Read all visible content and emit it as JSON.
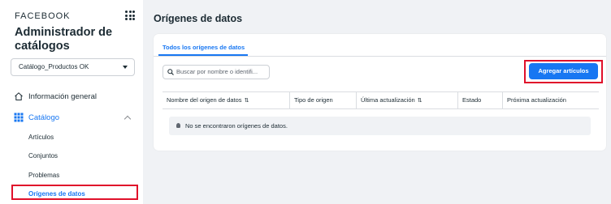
{
  "sidebar": {
    "brand": "FACEBOOK",
    "title": "Administrador de catálogos",
    "catalog_select": "Catálogo_Productos OK",
    "nav": {
      "general_info": "Información general",
      "catalog": "Catálogo"
    },
    "catalog_items": [
      "Artículos",
      "Conjuntos",
      "Problemas",
      "Orígenes de datos"
    ]
  },
  "main": {
    "title": "Orígenes de datos",
    "tab_all": "Todos los orígenes de datos",
    "search_placeholder": "Buscar por nombre o identifi...",
    "add_button": "Agregar artículos",
    "columns": [
      "Nombre del origen de datos",
      "Tipo de origen",
      "Última actualización",
      "Estado",
      "Próxima actualización"
    ],
    "sort_icon": "⇅",
    "empty_message": "No se encontraron orígenes de datos."
  },
  "colors": {
    "accent": "#1877f2",
    "highlight": "#e0102a",
    "background": "#f0f2f5"
  }
}
